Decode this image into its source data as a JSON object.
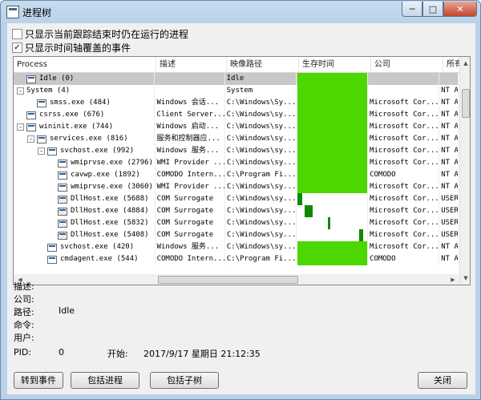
{
  "window": {
    "title": "进程树"
  },
  "options": [
    {
      "label": "只显示当前跟踪结束时仍在运行的进程",
      "checked": false
    },
    {
      "label": "只显示时间轴覆盖的事件",
      "checked": true
    }
  ],
  "columns": [
    "Process",
    "描述",
    "映像路径",
    "生存时间",
    "公司",
    "所有"
  ],
  "rows": [
    {
      "indent": 0,
      "toggle": "",
      "icon": "plain",
      "name": "Idle (0)",
      "desc": "",
      "path": "Idle",
      "company": "",
      "owner": "",
      "selected": true,
      "bar": [
        0,
        1.0
      ],
      "dark": false
    },
    {
      "indent": 0,
      "toggle": "-",
      "icon": "none",
      "name": "System (4)",
      "desc": "",
      "path": "System",
      "company": "",
      "owner": "NT A",
      "selected": false,
      "bar": [
        0,
        1.0
      ],
      "dark": false
    },
    {
      "indent": 1,
      "toggle": "",
      "icon": "plain",
      "name": "smss.exe (484)",
      "desc": "Windows 会话...",
      "path": "C:\\Windows\\Sy...",
      "company": "Microsoft Cor...",
      "owner": "NT A",
      "selected": false,
      "bar": [
        0,
        1.0
      ],
      "dark": false
    },
    {
      "indent": 0,
      "toggle": "",
      "icon": "plain",
      "name": "csrss.exe (676)",
      "desc": "Client Server...",
      "path": "C:\\Windows\\sy...",
      "company": "Microsoft Cor...",
      "owner": "NT A",
      "selected": false,
      "bar": [
        0,
        1.0
      ],
      "dark": false
    },
    {
      "indent": 0,
      "toggle": "-",
      "icon": "plain",
      "name": "wininit.exe (744)",
      "desc": "Windows 启动...",
      "path": "C:\\Windows\\sy...",
      "company": "Microsoft Cor...",
      "owner": "NT A",
      "selected": false,
      "bar": [
        0,
        1.0
      ],
      "dark": false
    },
    {
      "indent": 1,
      "toggle": "-",
      "icon": "plain",
      "name": "services.exe (816)",
      "desc": "服务和控制器应...",
      "path": "C:\\Windows\\sy...",
      "company": "Microsoft Cor...",
      "owner": "NT A",
      "selected": false,
      "bar": [
        0,
        1.0
      ],
      "dark": false
    },
    {
      "indent": 2,
      "toggle": "-",
      "icon": "plain",
      "name": "svchost.exe (992)",
      "desc": "Windows 服务...",
      "path": "C:\\Windows\\sy...",
      "company": "Microsoft Cor...",
      "owner": "NT A",
      "selected": false,
      "bar": [
        0,
        1.0
      ],
      "dark": false
    },
    {
      "indent": 3,
      "toggle": "",
      "icon": "plain",
      "name": "wmiprvse.exe (2796)",
      "desc": "WMI Provider ...",
      "path": "C:\\Windows\\sy...",
      "company": "Microsoft Cor...",
      "owner": "NT A",
      "selected": false,
      "bar": [
        0,
        1.0
      ],
      "dark": false
    },
    {
      "indent": 3,
      "toggle": "",
      "icon": "plain",
      "name": "cavwp.exe (1892)",
      "desc": "COMODO Intern...",
      "path": "C:\\Program Fi...",
      "company": "COMODO",
      "owner": "NT A",
      "selected": false,
      "bar": [
        0,
        1.0
      ],
      "dark": false
    },
    {
      "indent": 3,
      "toggle": "",
      "icon": "plain",
      "name": "wmiprvse.exe (3060)",
      "desc": "WMI Provider ...",
      "path": "C:\\Windows\\sy...",
      "company": "Microsoft Cor...",
      "owner": "NT A",
      "selected": false,
      "bar": [
        0,
        1.0
      ],
      "dark": false
    },
    {
      "indent": 3,
      "toggle": "",
      "icon": "grid",
      "name": "DllHost.exe (5688)",
      "desc": "COM Surrogate",
      "path": "C:\\Windows\\sy...",
      "company": "Microsoft Cor...",
      "owner": "USER",
      "selected": false,
      "bar": [
        0,
        0.07
      ],
      "dark": true
    },
    {
      "indent": 3,
      "toggle": "",
      "icon": "grid",
      "name": "DllHost.exe (4884)",
      "desc": "COM Surrogate",
      "path": "C:\\Windows\\sy...",
      "company": "Microsoft Cor...",
      "owner": "USER",
      "selected": false,
      "bar": [
        0.1,
        0.22
      ],
      "dark": true
    },
    {
      "indent": 3,
      "toggle": "",
      "icon": "grid",
      "name": "DllHost.exe (5832)",
      "desc": "COM Surrogate",
      "path": "C:\\Windows\\sy...",
      "company": "Microsoft Cor...",
      "owner": "USER",
      "selected": false,
      "bar": [
        0.43,
        0.45
      ],
      "dark": true
    },
    {
      "indent": 3,
      "toggle": "",
      "icon": "grid",
      "name": "DllHost.exe (5408)",
      "desc": "COM Surrogate",
      "path": "C:\\Windows\\sy...",
      "company": "Microsoft Cor...",
      "owner": "USER",
      "selected": false,
      "bar": [
        0.87,
        0.93
      ],
      "dark": true
    },
    {
      "indent": 2,
      "toggle": "",
      "icon": "plain",
      "name": "svchost.exe (420)",
      "desc": "Windows 服务...",
      "path": "C:\\Windows\\sy...",
      "company": "Microsoft Cor...",
      "owner": "NT A",
      "selected": false,
      "bar": [
        0,
        1.0
      ],
      "dark": false
    },
    {
      "indent": 2,
      "toggle": "",
      "icon": "plain",
      "name": "cmdagent.exe (544)",
      "desc": "COMODO Intern...",
      "path": "C:\\Program Fi...",
      "company": "COMODO",
      "owner": "NT A",
      "selected": false,
      "bar": [
        0,
        1.0
      ],
      "dark": false
    }
  ],
  "details": {
    "desc_label": "描述:",
    "company_label": "公司:",
    "path_label": "路径:",
    "path_value": "Idle",
    "cmd_label": "命令:",
    "user_label": "用户:",
    "pid_label": "PID:",
    "pid_value": "0",
    "start_label": "开始:",
    "start_value": "2017/9/17 星期日 21:12:35"
  },
  "buttons": {
    "goto_event": "转到事件",
    "include_process": "包括进程",
    "include_children": "包括子树",
    "close": "关闭"
  },
  "colors": {
    "bar": "#4dd700",
    "bar_dark": "#0d8a00",
    "selected_row": "#c8c8c8"
  }
}
